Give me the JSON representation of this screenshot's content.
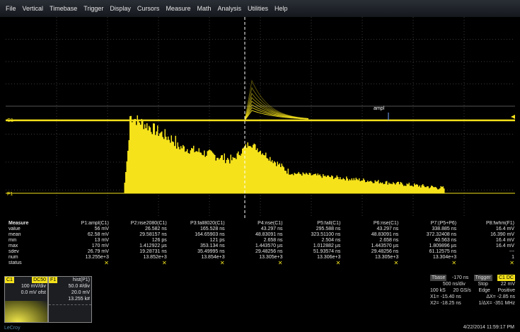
{
  "menu": [
    "File",
    "Vertical",
    "Timebase",
    "Trigger",
    "Display",
    "Cursors",
    "Measure",
    "Math",
    "Analysis",
    "Utilities",
    "Help"
  ],
  "trace": {
    "c1_label": "C1",
    "f1_label": "F1",
    "cursor_label": "ampl",
    "color": "#f5e21b"
  },
  "measure": {
    "row_labels": [
      "Measure",
      "value",
      "mean",
      "min",
      "max",
      "sdev",
      "num",
      "status"
    ],
    "columns": [
      {
        "header": "P1:ampl(C1)",
        "value": "56 mV",
        "mean": "62.58 mV",
        "min": "13 mV",
        "max": "170 mV",
        "sdev": "26.79 mV",
        "num": "13.255e+3"
      },
      {
        "header": "P2:rise2080(C1)",
        "value": "26.582 ns",
        "mean": "29.58157 ns",
        "min": "126 ps",
        "max": "1.412922 µs",
        "sdev": "19.28731 ns",
        "num": "13.852e+3"
      },
      {
        "header": "P3:fall8020(C1)",
        "value": "165.528 ns",
        "mean": "164.65903 ns",
        "min": "121 ps",
        "max": "353.134 ns",
        "sdev": "35.49995 ns",
        "num": "13.854e+3"
      },
      {
        "header": "P4:rise(C1)",
        "value": "43.297 ns",
        "mean": "48.83091 ns",
        "min": "2.658 ns",
        "max": "1.443570 µs",
        "sdev": "29.48256 ns",
        "num": "13.305e+3"
      },
      {
        "header": "P5:fall(C1)",
        "value": "295.588 ns",
        "mean": "323.51100 ns",
        "min": "2.504 ns",
        "max": "1.012882 µs",
        "sdev": "51.93574 ns",
        "num": "13.306e+3"
      },
      {
        "header": "P6:rise(C1)",
        "value": "43.297 ns",
        "mean": "48.83091 ns",
        "min": "2.658 ns",
        "max": "1.443570 µs",
        "sdev": "29.48256 ns",
        "num": "13.305e+3"
      },
      {
        "header": "P7:(P5+P6)",
        "value": "338.885 ns",
        "mean": "372.32408 ns",
        "min": "40.563 ns",
        "max": "1.809896 µs",
        "sdev": "61.12575 ns",
        "num": "13.304e+3"
      },
      {
        "header": "P8:fwhm(F1)",
        "value": "16.4 mV",
        "mean": "16.390 mV",
        "min": "16.4 mV",
        "max": "16.4 mV",
        "sdev": "---",
        "num": "1"
      }
    ]
  },
  "c1_box": {
    "badge": "C1",
    "mode": "DC50",
    "vdiv": "100 mV/div",
    "offset": "0.0 mV ofst"
  },
  "f1_box": {
    "badge": "F1",
    "title": "hist(P1)",
    "vdiv": "50.0 #/div",
    "offset": "20.0 mV",
    "count": "13.255 k#"
  },
  "timebase": {
    "tbase_label": "Tbase",
    "tbase_val": "-170 ns",
    "trigger_label": "Trigger",
    "trigger_badge": "C1 DC",
    "tdiv": "500 ns/div",
    "trig_mode": "Stop",
    "trig_level": "22 mV",
    "samples": "100 kS",
    "rate": "20 GS/s",
    "trig_type": "Edge",
    "trig_slope": "Positive",
    "x1": "X1=  -15.40 ns",
    "dx": "ΔX=   -2.85 ns",
    "x2": "X2=  -18.25 ns",
    "inv_dx": "1/ΔX=  -351 MHz"
  },
  "timestamp": "4/22/2014 11:59:17 PM",
  "brand": "LeCroy"
}
